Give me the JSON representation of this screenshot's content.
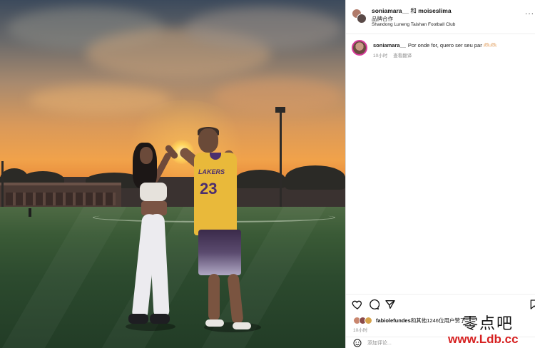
{
  "header": {
    "user1": "soniamara__",
    "joiner": "和",
    "user2": "moiseslima",
    "subtitle": "品牌合作",
    "location": "Shandong Luneng Taishan Football Club",
    "more_icon": "more-dots-icon"
  },
  "caption": {
    "username": "soniamara__",
    "text": "Por onde for, quero ser seu par 🫶🏻🫶🏻",
    "time": "10小时",
    "translate": "查看翻译"
  },
  "photo": {
    "jersey_brand": "LAKERS",
    "jersey_number": "23"
  },
  "actions": {
    "like_icon": "heart-icon",
    "comment_icon": "comment-icon",
    "share_icon": "share-icon",
    "save_icon": "bookmark-icon"
  },
  "likes": {
    "username": "fabiolefundes",
    "text": "和其他1246位用户赞了"
  },
  "post_time": "10小时",
  "comment": {
    "placeholder": "添加评论..."
  },
  "watermark": {
    "line1": "零点吧",
    "line2": "www.Ldb.cc"
  },
  "colors": {
    "jersey_gold": "#e9b93a",
    "jersey_purple": "#4c2f6e",
    "story_ring": "#d83a9b"
  }
}
